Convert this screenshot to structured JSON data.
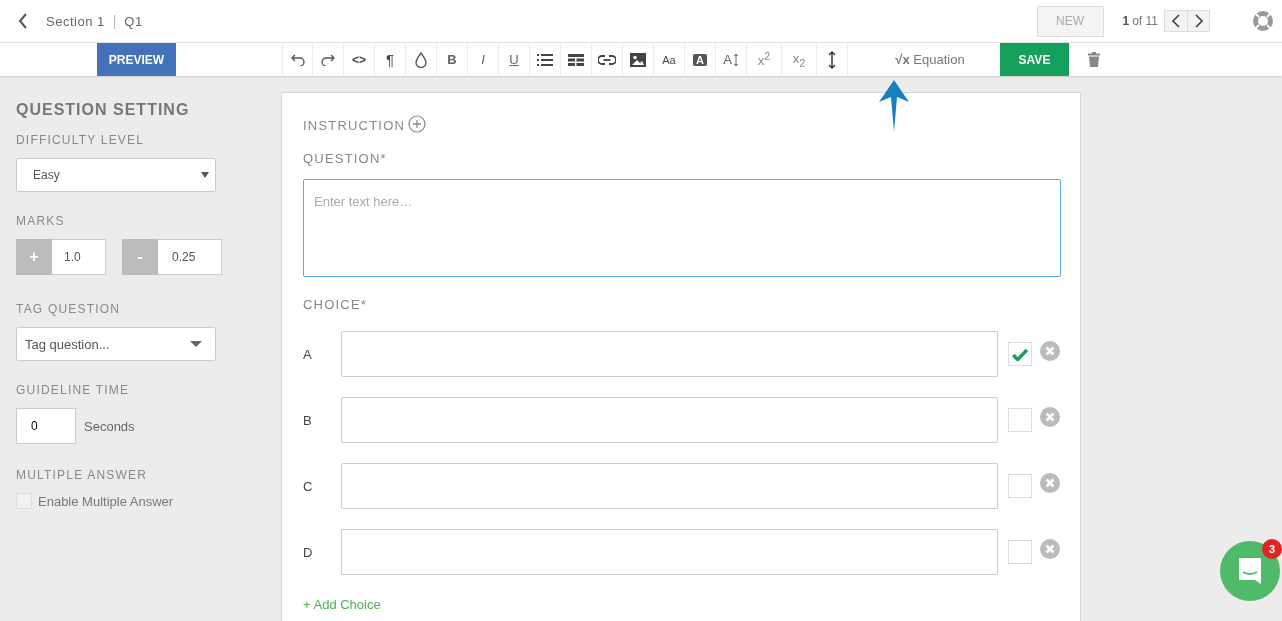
{
  "header": {
    "section": "Section 1",
    "separator": "|",
    "question": "Q1",
    "new_button": "NEW",
    "pager": {
      "current": "1",
      "total": "of 11"
    }
  },
  "toolbar": {
    "preview": "PREVIEW",
    "text_buttons": [
      "<>",
      "¶",
      "B",
      "I",
      "U",
      "Aa",
      "A",
      "A",
      "x$^{2}$",
      "x$_{2}$"
    ],
    "equation": {
      "symbol": "√x",
      "label": "Equation"
    },
    "save": "SAVE"
  },
  "settings": {
    "title": "QUESTION SETTING",
    "difficulty": {
      "label": "DIFFICULTY LEVEL",
      "value": "Easy"
    },
    "marks": {
      "label": "MARKS",
      "positive": {
        "sign": "+",
        "value": "1.0"
      },
      "negative": {
        "sign": "-",
        "value": "0.25"
      }
    },
    "tag": {
      "label": "TAG QUESTION",
      "placeholder": "Tag question..."
    },
    "time": {
      "label": "GUIDELINE TIME",
      "value": "0",
      "unit": "Seconds"
    },
    "multiple": {
      "label": "MULTIPLE ANSWER",
      "option": "Enable Multiple Answer",
      "checked": false
    }
  },
  "editor": {
    "instruction": "INSTRUCTION",
    "question_label": "QUESTION*",
    "question_placeholder": "Enter text here…",
    "choice_label": "CHOICE*",
    "choices": [
      {
        "letter": "A",
        "correct": true
      },
      {
        "letter": "B",
        "correct": false
      },
      {
        "letter": "C",
        "correct": false
      },
      {
        "letter": "D",
        "correct": false
      }
    ],
    "add_choice": "+ Add Choice"
  },
  "chat": {
    "badge": "3"
  }
}
